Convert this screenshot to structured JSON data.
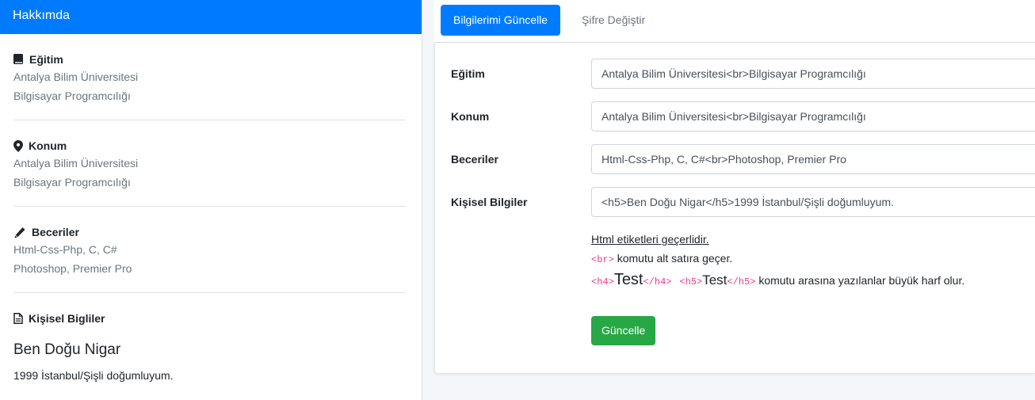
{
  "about": {
    "header": "Hakkımda",
    "sections": [
      {
        "icon": "book-icon",
        "title": "Eğitim",
        "lines": [
          "Antalya Bilim Üniversitesi",
          "Bilgisayar Programcılığı"
        ]
      },
      {
        "icon": "map-marker-icon",
        "title": "Konum",
        "lines": [
          "Antalya Bilim Üniversitesi",
          "Bilgisayar Programcılığı"
        ]
      },
      {
        "icon": "pencil-icon",
        "title": "Beceriler",
        "lines": [
          "Html-Css-Php, C, C#",
          "Photoshop, Premier Pro"
        ]
      },
      {
        "icon": "file-text-icon",
        "title": "Kişisel Bigliler"
      }
    ],
    "personal_name": "Ben Doğu Nigar",
    "personal_desc": "1999 İstanbul/Şişli doğumluyum."
  },
  "tabs": [
    {
      "label": "Bilgilerimi Güncelle",
      "active": true
    },
    {
      "label": "Şifre Değiştir",
      "active": false
    }
  ],
  "form": {
    "fields": [
      {
        "label": "Eğitim",
        "value": "Antalya Bilim Üniversitesi<br>Bilgisayar Programcılığı"
      },
      {
        "label": "Konum",
        "value": "Antalya Bilim Üniversitesi<br>Bilgisayar Programcılığı"
      },
      {
        "label": "Beceriler",
        "value": "Html-Css-Php, C, C#<br>Photoshop, Premier Pro"
      },
      {
        "label": "Kişisel Bilgiler",
        "value": "<h5>Ben Doğu Nigar</h5>1999 İstanbul/Şişli doğumluyum."
      }
    ],
    "help": {
      "title": "Html etiketleri geçerlidir.",
      "br_tag": "<br>",
      "br_text": "komutu alt satıra geçer.",
      "h4_open": "<h4>",
      "h4_word": "Test",
      "h4_close": "</h4>",
      "h5_open": "<h5>",
      "h5_word": "Test",
      "h5_close": "</h5>",
      "h_text": "komutu arasına yazılanlar büyük harf olur."
    },
    "submit_label": "Güncelle"
  },
  "colors": {
    "primary": "#007bff",
    "success": "#28a745",
    "code": "#e83e8c",
    "muted": "#6c757d"
  }
}
